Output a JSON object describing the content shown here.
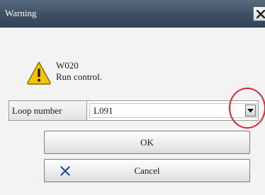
{
  "window": {
    "title": "Warning"
  },
  "message": {
    "code": "W020",
    "text": "Run control.",
    "icon": "warning-triangle-icon"
  },
  "loop_number": {
    "label": "Loop number",
    "value": "L091"
  },
  "buttons": {
    "ok_label": "OK",
    "cancel_label": "Cancel"
  },
  "colors": {
    "titlebar": "#3f4f63",
    "highlight_circle": "#e0242a",
    "warning_fill": "#f5c400",
    "cancel_icon": "#1f4e96"
  }
}
